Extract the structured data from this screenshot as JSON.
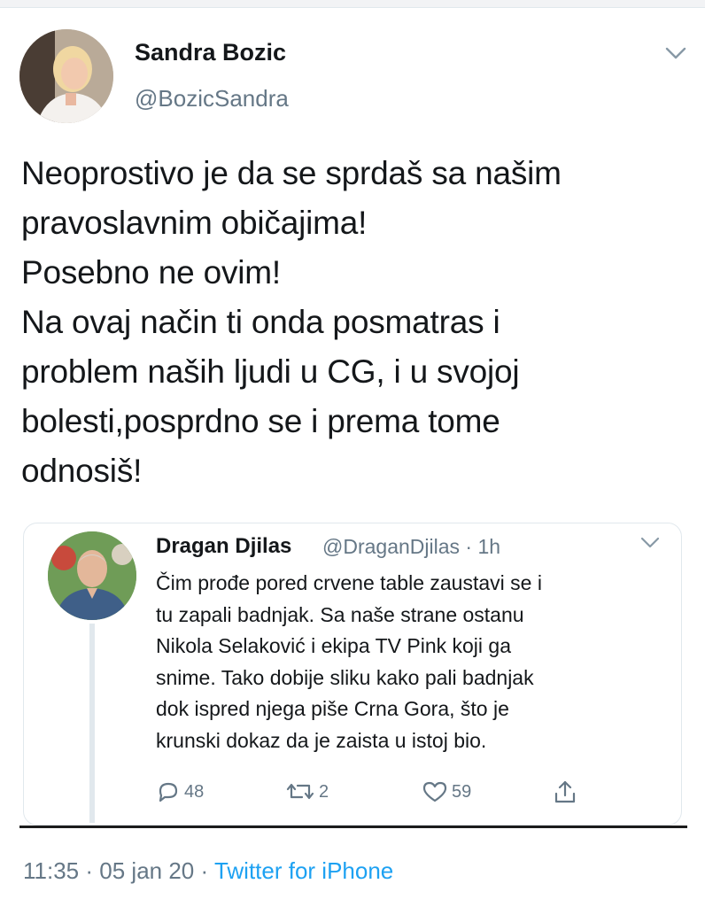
{
  "tweet": {
    "author_name": "Sandra Bozic",
    "author_handle": "@BozicSandra",
    "text_lines": [
      "Neoprostivo je da se sprdaš sa našim",
      "pravoslavnim običajima!",
      "Posebno ne ovim!",
      "Na ovaj način ti onda posmatras i",
      "problem naših ljudi u CG, i u svojoj",
      "bolesti,posprdno se i prema tome",
      "odnosiš!"
    ],
    "time": "11:35",
    "date": "05 jan 20",
    "source": "Twitter for iPhone",
    "separator": "·"
  },
  "quoted": {
    "author_name": "Dragan Djilas",
    "author_handle": "@DraganDjilas",
    "age": "1h",
    "text_lines": [
      "Čim prođe pored crvene table zaustavi se i",
      "tu zapali badnjak. Sa naše strane ostanu",
      "Nikola Selaković i ekipa TV Pink koji ga",
      "snime. Tako dobije sliku kako pali badnjak",
      "dok ispred njega piše Crna Gora, što je",
      "krunski dokaz da je zaista u istoj bio."
    ],
    "reply_count": "48",
    "retweet_count": "2",
    "like_count": "59"
  },
  "icons": [
    "chevron-down-icon",
    "reply-icon",
    "retweet-icon",
    "like-icon",
    "share-icon"
  ],
  "colors": {
    "text": "#14171a",
    "secondary": "#657786",
    "link": "#1da1f2",
    "border": "#e1e8ed"
  }
}
